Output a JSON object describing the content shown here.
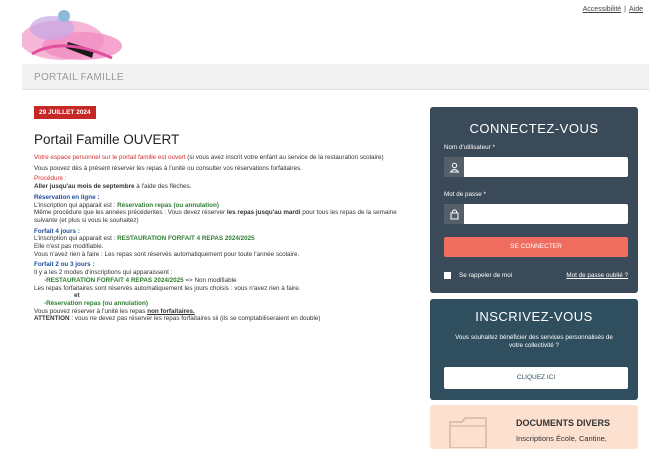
{
  "header": {
    "links": [
      "Accessibilité",
      "Aide"
    ],
    "separator": "|"
  },
  "page": {
    "title": "PORTAIL FAMILLE"
  },
  "article": {
    "date": "29 JUILLET 2024",
    "title": "Portail Famille OUVERT",
    "lines": {
      "intro_red": "Votre espace personnel sur le portail famille est ouvert",
      "intro_rest": " (si vous avez inscrit votre enfant au service de la restauration scolaire)",
      "l2": "Vous pouvez dès à présent réserver les repas à l'unité ou consulter vos réservations forfaitaires.",
      "procedure": "Procédure :",
      "aller_bold": "Aller jusqu'au mois de septembre",
      "aller_rest": " à l'aide des flèches.",
      "resa_title": "Réservation en ligne :",
      "resa_l1_a": "L'inscription qui apparait est : ",
      "resa_l1_green": "Réservation repas (ou annulation)",
      "resa_l2_a": "Même procédure que les années précédentes : Vous devez réserver ",
      "resa_l2_bold": "les repas jusqu'au mardi",
      "resa_l2_b": " pour tous les repas de la semaine suivante (et plus si vous le souhaitez)",
      "f4_title": "Forfait 4 jours :",
      "f4_l1_a": "L'inscription qui apparait est : ",
      "f4_l1_green": "RESTAURATION FORFAIT 4 REPAS 2024/2025",
      "f4_l2": "Elle n'est pas modifiable.",
      "f4_l3": "Vous n'avez rien à faire : Les repas sont réservés automatiquement pour toute l'année scolaire.",
      "f23_title": "Forfait 2 ou 3 jours :",
      "f23_l1": "Il y a les 2 modes d'inscriptions qui apparaissent :",
      "f23_l2_green": "-RESTAURATION FORFAIT 4 REPAS 2024/2025",
      "f23_l2_rest": "  =>  Non modifiable",
      "f23_l3": "Les repas forfaitaires sont réservés automatiquement les jours choisis : vous n'avez rien à faire.",
      "et": "et",
      "f23_l4_green": "-Réservation repas (ou annulation)",
      "f23_l5_a": "Vous pouvez réserver à l'unité les repas ",
      "f23_l5_u": "non forfaitaires.",
      "att_bold": "ATTENTION",
      "att_rest": " : vous ne devez pas réserver les repas forfaitaires sii (ils se comptabiliseraient en double)"
    }
  },
  "login": {
    "title": "CONNECTEZ-VOUS",
    "username_label": "Nom d'utilisateur *",
    "password_label": "Mot de passe *",
    "submit": "SE CONNECTER",
    "remember": "Se rappeler de moi",
    "forgot": "Mot de passe oublié ?"
  },
  "signup": {
    "title": "INSCRIVEZ-VOUS",
    "text": "Vous souhaitez bénéficier des services personnalisés de votre collectivité ?",
    "button": "CLIQUEZ ICI"
  },
  "documents": {
    "title": "DOCUMENTS DIVERS",
    "subtitle": "Inscriptions École, Cantine,"
  },
  "colors": {
    "date_badge": "#c62828",
    "login_panel": "#3b4a58",
    "signup_panel": "#2f4f5f",
    "connect_button": "#ef6d5f",
    "docs_panel": "#fce1d1"
  }
}
